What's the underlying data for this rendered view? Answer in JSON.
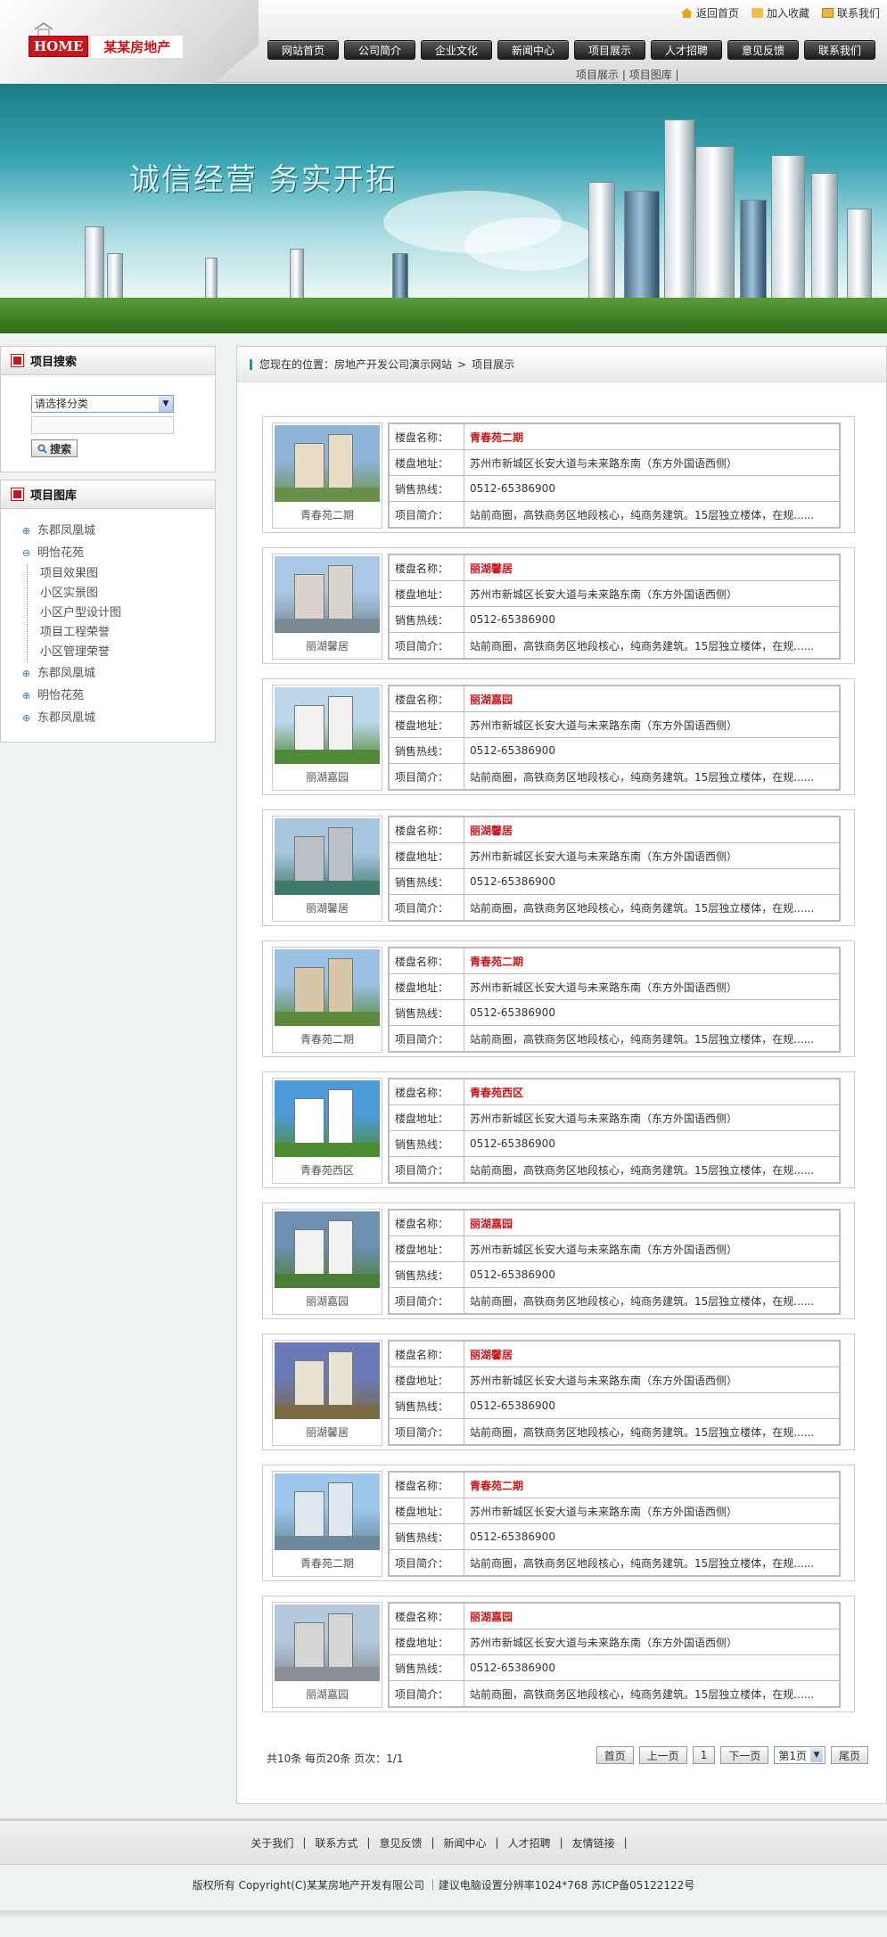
{
  "header": {
    "logo_home": "HOME",
    "logo_name": "某某房地产",
    "top_links": [
      {
        "label": "返回首页",
        "icon": "home-icon"
      },
      {
        "label": "加入收藏",
        "icon": "favorite-icon"
      },
      {
        "label": "联系我们",
        "icon": "mail-icon"
      }
    ],
    "nav": [
      "网站首页",
      "公司简介",
      "企业文化",
      "新闻中心",
      "项目展示",
      "人才招聘",
      "意见反馈",
      "联系我们"
    ],
    "subnav": [
      "项目展示",
      "项目图库"
    ]
  },
  "banner": {
    "slogan": "诚信经营 务实开拓"
  },
  "sidebar": {
    "search": {
      "title": "项目搜索",
      "select_value": "请选择分类",
      "button_label": "搜索"
    },
    "gallery": {
      "title": "项目图库",
      "tree": [
        {
          "label": "东郡凤凰城",
          "children": []
        },
        {
          "label": "明怡花苑",
          "children": [
            "项目效果图",
            "小区实景图",
            "小区户型设计图",
            "项目工程荣誉",
            "小区管理荣誉"
          ]
        },
        {
          "label": "东郡凤凰城",
          "children": []
        },
        {
          "label": "明怡花苑",
          "children": []
        },
        {
          "label": "东郡凤凰城",
          "children": []
        }
      ]
    }
  },
  "breadcrumb": {
    "prefix": "您现在的位置：",
    "home": "房地产开发公司演示网站",
    "sep": ">",
    "current": "项目展示"
  },
  "labels": {
    "name": "楼盘名称：",
    "address": "楼盘地址：",
    "phone": "销售热线：",
    "intro": "项目简介："
  },
  "projects": [
    {
      "caption": "青春苑二期",
      "name": "青春苑二期",
      "address": "苏州市新城区长安大道与未来路东南（东方外国语西侧）",
      "phone": "0512-65386900",
      "intro": "站前商圈，高铁商务区地段核心，纯商务建筑。15层独立楼体，在规......"
    },
    {
      "caption": "丽湖馨居",
      "name": "丽湖馨居",
      "address": "苏州市新城区长安大道与未来路东南（东方外国语西侧）",
      "phone": "0512-65386900",
      "intro": "站前商圈，高铁商务区地段核心，纯商务建筑。15层独立楼体，在规......"
    },
    {
      "caption": "丽湖嘉园",
      "name": "丽湖嘉园",
      "address": "苏州市新城区长安大道与未来路东南（东方外国语西侧）",
      "phone": "0512-65386900",
      "intro": "站前商圈，高铁商务区地段核心，纯商务建筑。15层独立楼体，在规......"
    },
    {
      "caption": "丽湖馨居",
      "name": "丽湖馨居",
      "address": "苏州市新城区长安大道与未来路东南（东方外国语西侧）",
      "phone": "0512-65386900",
      "intro": "站前商圈，高铁商务区地段核心，纯商务建筑。15层独立楼体，在规......"
    },
    {
      "caption": "青春苑二期",
      "name": "青春苑二期",
      "address": "苏州市新城区长安大道与未来路东南（东方外国语西侧）",
      "phone": "0512-65386900",
      "intro": "站前商圈，高铁商务区地段核心，纯商务建筑。15层独立楼体，在规......"
    },
    {
      "caption": "青春苑西区",
      "name": "青春苑西区",
      "address": "苏州市新城区长安大道与未来路东南（东方外国语西侧）",
      "phone": "0512-65386900",
      "intro": "站前商圈，高铁商务区地段核心，纯商务建筑。15层独立楼体，在规......"
    },
    {
      "caption": "丽湖嘉园",
      "name": "丽湖嘉园",
      "address": "苏州市新城区长安大道与未来路东南（东方外国语西侧）",
      "phone": "0512-65386900",
      "intro": "站前商圈，高铁商务区地段核心，纯商务建筑。15层独立楼体，在规......"
    },
    {
      "caption": "丽湖馨居",
      "name": "丽湖馨居",
      "address": "苏州市新城区长安大道与未来路东南（东方外国语西侧）",
      "phone": "0512-65386900",
      "intro": "站前商圈，高铁商务区地段核心，纯商务建筑。15层独立楼体，在规......"
    },
    {
      "caption": "青春苑二期",
      "name": "青春苑二期",
      "address": "苏州市新城区长安大道与未来路东南（东方外国语西侧）",
      "phone": "0512-65386900",
      "intro": "站前商圈，高铁商务区地段核心，纯商务建筑。15层独立楼体，在规......"
    },
    {
      "caption": "丽湖嘉园",
      "name": "丽湖嘉园",
      "address": "苏州市新城区长安大道与未来路东南（东方外国语西侧）",
      "phone": "0512-65386900",
      "intro": "站前商圈，高铁商务区地段核心，纯商务建筑。15层独立楼体，在规......"
    }
  ],
  "pager": {
    "summary": "共10条  每页20条  页次：1/1",
    "first": "首页",
    "prev": "上一页",
    "current": "1",
    "next": "下一页",
    "select_value": "第1页",
    "last": "尾页"
  },
  "footer": {
    "links": [
      "关于我们",
      "联系方式",
      "意见反馈",
      "新闻中心",
      "人才招聘",
      "友情链接"
    ],
    "copyright": "版权所有  Copyright(C)某某房地产开发有限公司  ｜建议电脑设置分辨率1024*768 苏ICP备05122122号"
  },
  "colors": {
    "accent": "#c7161c",
    "nav_bg": "#2a2a2a",
    "page_bg": "#eef3f1"
  }
}
